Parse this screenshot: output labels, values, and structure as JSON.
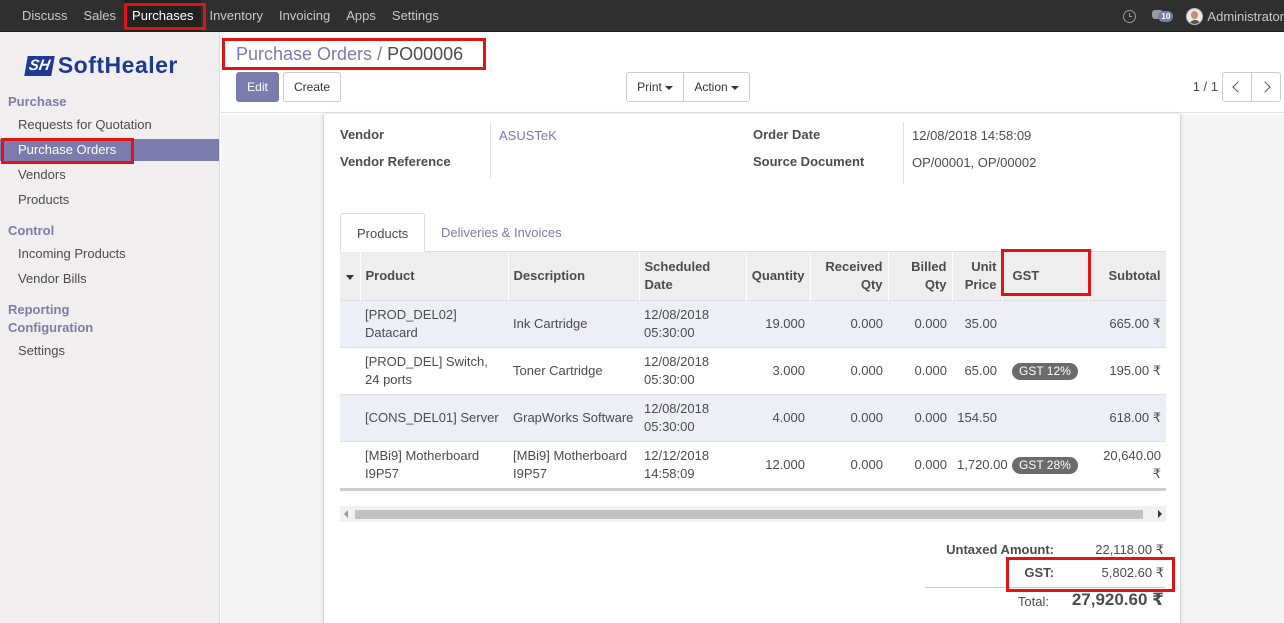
{
  "topmenu": {
    "items": [
      "Discuss",
      "Sales",
      "Purchases",
      "Inventory",
      "Invoicing",
      "Apps",
      "Settings"
    ],
    "chat_count": "10",
    "user": "Administrator"
  },
  "logo": {
    "mark": "SH",
    "text": "SoftHealer"
  },
  "sidebar": {
    "section_purchase": "Purchase",
    "rfq": "Requests for Quotation",
    "purchase_orders": "Purchase Orders",
    "vendors": "Vendors",
    "products": "Products",
    "section_control": "Control",
    "incoming_products": "Incoming Products",
    "vendor_bills": "Vendor Bills",
    "section_reporting": "Reporting",
    "section_configuration": "Configuration",
    "settings": "Settings"
  },
  "header": {
    "breadcrumb_parent": "Purchase Orders",
    "breadcrumb_sep": " / ",
    "record_name": "PO00006",
    "edit": "Edit",
    "create": "Create",
    "print": "Print",
    "action": "Action",
    "pager": "1 / 1"
  },
  "form": {
    "vendor_label": "Vendor",
    "vendor_value": "ASUSTeK",
    "vendor_ref_label": "Vendor Reference",
    "order_date_label": "Order Date",
    "order_date_value": "12/08/2018 14:58:09",
    "source_doc_label": "Source Document",
    "source_doc_value": "OP/00001, OP/00002"
  },
  "tabs": {
    "products": "Products",
    "deliveries": "Deliveries & Invoices"
  },
  "table": {
    "headers": {
      "product": "Product",
      "description": "Description",
      "scheduled_date": "Scheduled Date",
      "quantity": "Quantity",
      "received_qty": "Received Qty",
      "billed_qty": "Billed Qty",
      "unit_price": "Unit Price",
      "gst": "GST",
      "subtotal": "Subtotal"
    },
    "rows": [
      {
        "product": "[PROD_DEL02] Datacard",
        "description": "Ink Cartridge",
        "scheduled_date": "12/08/2018 05:30:00",
        "quantity": "19.000",
        "received_qty": "0.000",
        "billed_qty": "0.000",
        "unit_price": "35.00",
        "gst": "",
        "subtotal": "665.00 ₹"
      },
      {
        "product": "[PROD_DEL] Switch, 24 ports",
        "description": "Toner Cartridge",
        "scheduled_date": "12/08/2018 05:30:00",
        "quantity": "3.000",
        "received_qty": "0.000",
        "billed_qty": "0.000",
        "unit_price": "65.00",
        "gst": "GST 12%",
        "subtotal": "195.00 ₹"
      },
      {
        "product": "[CONS_DEL01] Server",
        "description": "GrapWorks Software",
        "scheduled_date": "12/08/2018 05:30:00",
        "quantity": "4.000",
        "received_qty": "0.000",
        "billed_qty": "0.000",
        "unit_price": "154.50",
        "gst": "",
        "subtotal": "618.00 ₹"
      },
      {
        "product": "[MBi9] Motherboard I9P57",
        "description": "[MBi9] Motherboard I9P57",
        "scheduled_date": "12/12/2018 14:58:09",
        "quantity": "12.000",
        "received_qty": "0.000",
        "billed_qty": "0.000",
        "unit_price": "1,720.00",
        "gst": "GST 28%",
        "subtotal": "20,640.00 ₹"
      }
    ]
  },
  "totals": {
    "untaxed_label": "Untaxed Amount:",
    "untaxed_value": "22,118.00 ₹",
    "gst_label": "GST:",
    "gst_value": "5,802.60 ₹",
    "total_label": "Total:",
    "total_value": "27,920.60 ₹"
  },
  "colors": {
    "accent": "#7c7bad",
    "topbar": "#2f2f2f",
    "highlight": "#e01414"
  }
}
